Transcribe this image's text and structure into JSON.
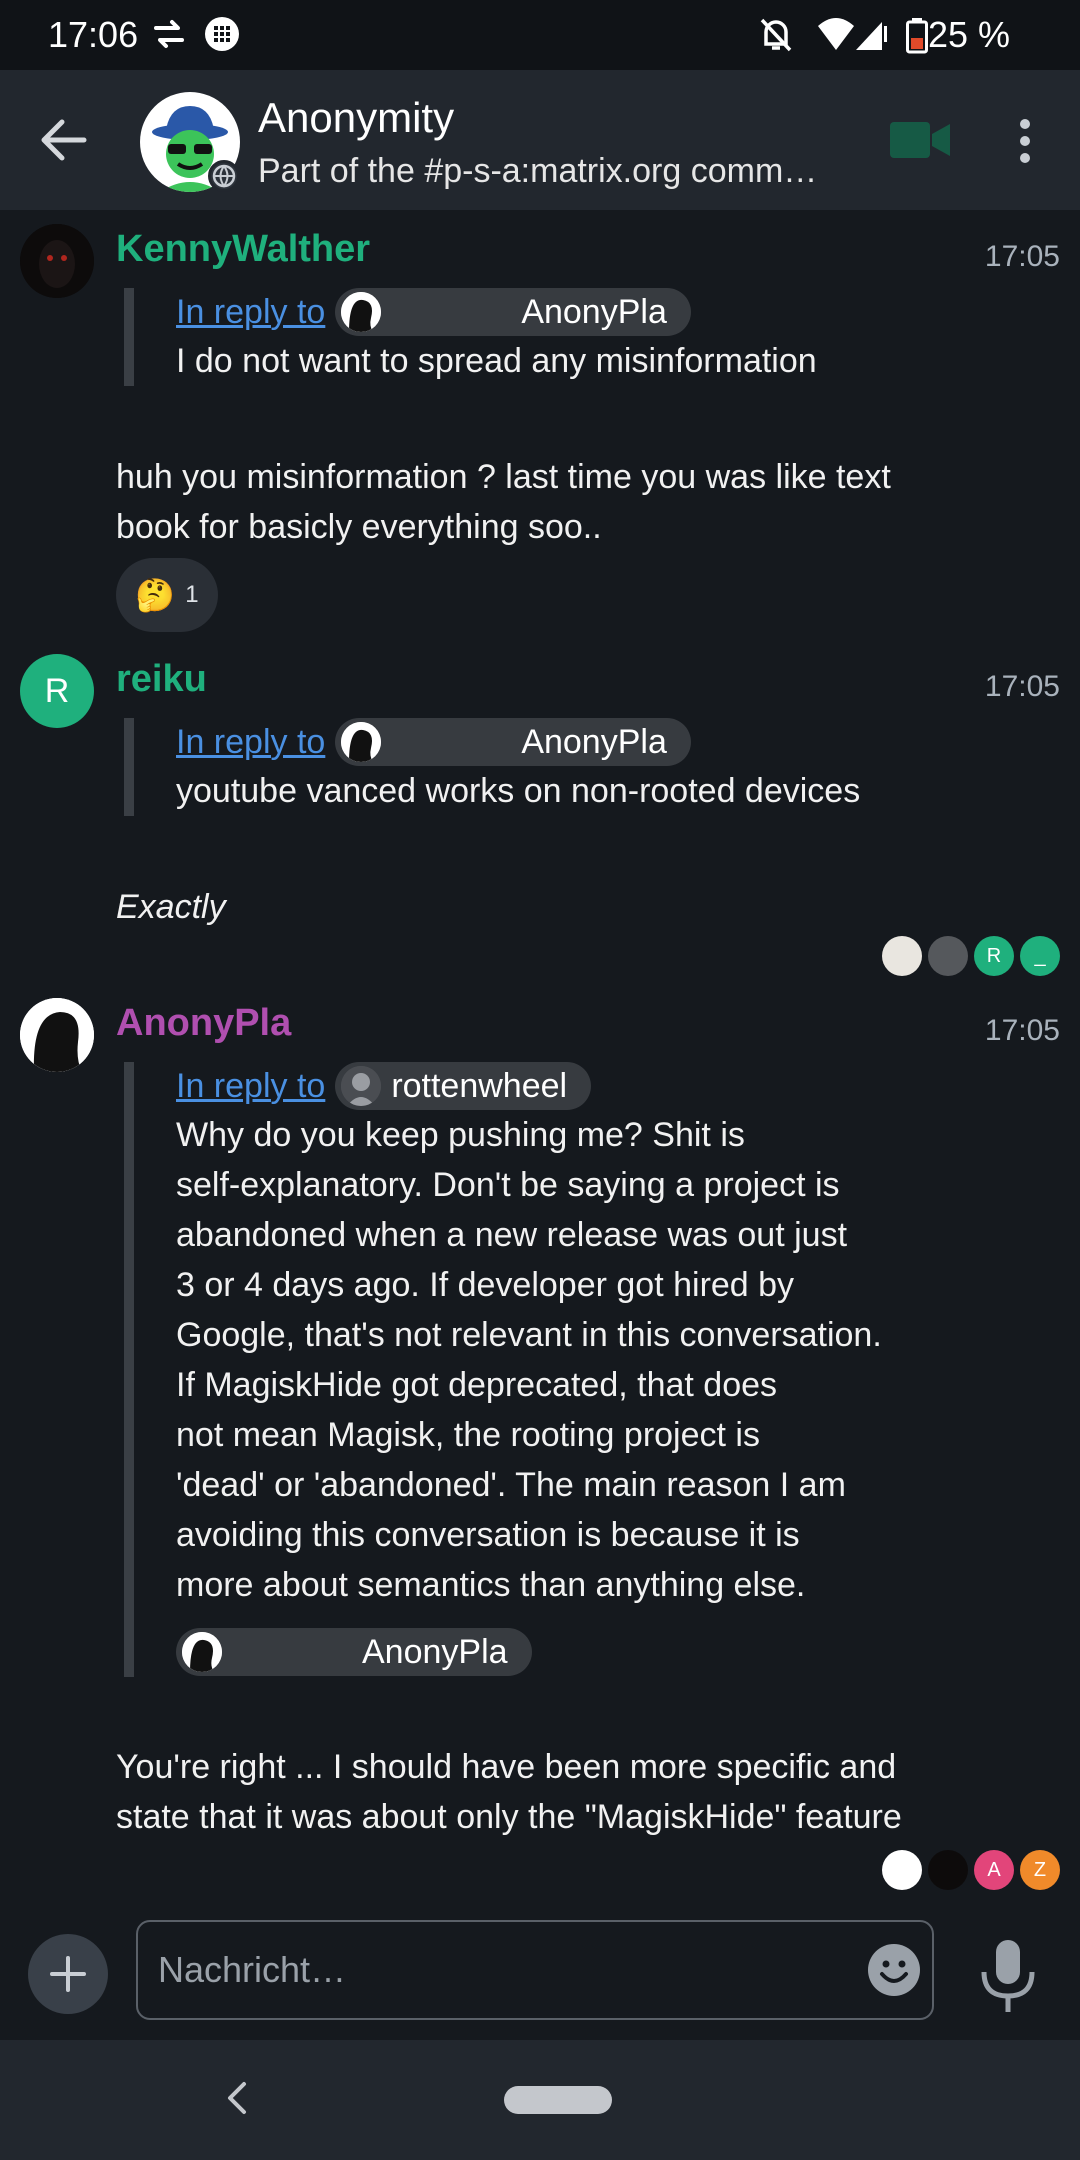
{
  "status_bar": {
    "time": "17:06",
    "battery": "25 %",
    "icons": [
      "data-transfer-icon",
      "grid-icon",
      "mute-icon",
      "wifi-icon",
      "signal-icon",
      "battery-low-icon"
    ]
  },
  "header": {
    "room_name": "Anonymity",
    "room_topic": "Part of the #p-s-a:matrix.org comm…",
    "back_icon": "arrow-left-icon",
    "video_icon": "video-call-icon",
    "more_icon": "more-vert-icon"
  },
  "messages": [
    {
      "sender": "KennyWalther",
      "sender_color": "#1fb07d",
      "time": "17:05",
      "reply_label": "In reply to",
      "reply_user": "AnonyPla",
      "quote": "I do not want to spread any misinformation",
      "body": "huh you misinformation ? last time you was like text book for basicly everything soo..",
      "reaction": {
        "emoji": "🤔",
        "count": "1"
      }
    },
    {
      "sender": "reiku",
      "sender_color": "#1fb07d",
      "avatar_letter": "R",
      "time": "17:05",
      "reply_label": "In reply to",
      "reply_user": "AnonyPla",
      "quote": "youtube vanced works on non-rooted devices",
      "body": "Exactly",
      "receipts": [
        "",
        "",
        "R",
        "_"
      ]
    },
    {
      "sender": "AnonyPla",
      "sender_color": "#b04fb0",
      "time": "17:05",
      "reply_label": "In reply to",
      "reply_user": "rottenwheel",
      "quote_lines": [
        "Why do you keep pushing me? Shit is",
        "self-explanatory. Don't be saying a project is",
        "abandoned when a new release was out just",
        "3 or 4 days ago. If developer got hired by",
        "Google, that's not relevant in this conversation.",
        "If MagiskHide got deprecated, that does",
        "not mean Magisk, the rooting project is",
        "'dead' or 'abandoned'. The main reason I am",
        "avoiding this conversation is because it is",
        "more about semantics than anything else."
      ],
      "quote_footer_user": "AnonyPla",
      "body_lines": [
        "You're right ... I should have been more specific and",
        "state that it was about only the \"MagiskHide\" feature"
      ],
      "receipts": [
        "",
        "",
        "A",
        "Z"
      ]
    }
  ],
  "composer": {
    "placeholder": "Nachricht…",
    "add_icon": "plus-icon",
    "emoji_icon": "emoji-icon",
    "mic_icon": "microphone-icon"
  },
  "colors": {
    "background": "#15191e",
    "appbar": "#22272e",
    "link": "#4a90e2",
    "accent_green": "#1fb07d",
    "accent_purple": "#b04fb0"
  }
}
